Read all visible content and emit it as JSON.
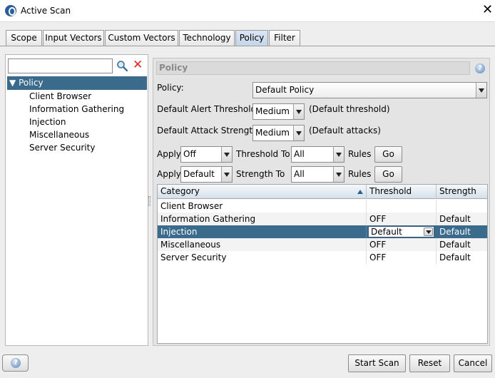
{
  "window": {
    "title": "Active Scan",
    "app_icon": "zap-icon",
    "close_glyph": "✕"
  },
  "tabs": [
    {
      "label": "Scope"
    },
    {
      "label": "Input Vectors"
    },
    {
      "label": "Custom Vectors"
    },
    {
      "label": "Technology"
    },
    {
      "label": "Policy",
      "active": true
    },
    {
      "label": "Filter"
    }
  ],
  "sidebar": {
    "search_value": "",
    "clear_glyph": "✕",
    "root": {
      "expander": "▼",
      "label": "Policy"
    },
    "items": [
      {
        "label": "Client Browser"
      },
      {
        "label": "Information Gathering"
      },
      {
        "label": "Injection"
      },
      {
        "label": "Miscellaneous"
      },
      {
        "label": "Server Security"
      }
    ]
  },
  "policy_panel": {
    "title": "Policy",
    "help_glyph": "?",
    "policy_label": "Policy:",
    "policy_value": "Default Policy",
    "alert_threshold_label": "Default Alert Threshold:",
    "alert_threshold_value": "Medium",
    "alert_threshold_hint": "(Default threshold)",
    "attack_strength_label": "Default Attack Strength:",
    "attack_strength_value": "Medium",
    "attack_strength_hint": "(Default attacks)",
    "apply_threshold": {
      "apply_label": "Apply",
      "apply_value": "Off",
      "to_label": "Threshold To",
      "to_value": "All",
      "rules_label": "Rules",
      "go_label": "Go"
    },
    "apply_strength": {
      "apply_label": "Apply",
      "apply_value": "Default",
      "to_label": "Strength To",
      "to_value": "All",
      "rules_label": "Rules",
      "go_label": "Go"
    }
  },
  "table": {
    "columns": [
      "Category",
      "Threshold",
      "Strength"
    ],
    "rows": [
      {
        "category": "Client Browser",
        "threshold": "",
        "strength": ""
      },
      {
        "category": "Information Gathering",
        "threshold": "OFF",
        "strength": "Default"
      },
      {
        "category": "Injection",
        "threshold": "Default",
        "strength": "Default",
        "selected": true
      },
      {
        "category": "Miscellaneous",
        "threshold": "OFF",
        "strength": "Default"
      },
      {
        "category": "Server Security",
        "threshold": "OFF",
        "strength": "Default"
      }
    ]
  },
  "footer": {
    "help_glyph": "?",
    "start_scan_label": "Start Scan",
    "reset_label": "Reset",
    "cancel_label": "Cancel"
  },
  "colors": {
    "selection": "#3a6a8c",
    "clear_icon": "#e0251c",
    "tab_active": "#c3d5ea"
  }
}
